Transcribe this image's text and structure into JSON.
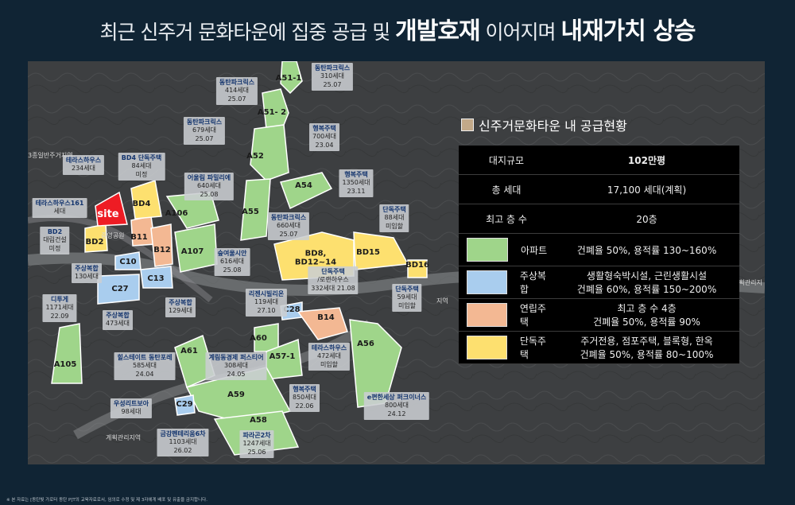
{
  "headline": {
    "p1": "최근 신주거 문화타운에 집중 공급 및 ",
    "b1": "개발호재",
    "p2": " 이어지며 ",
    "b2": "내재가치 상승"
  },
  "site_label": "site",
  "zones": {
    "A51_1": "A51-1",
    "A51_2": "A51-\n2",
    "A52": "A52",
    "A54": "A54",
    "A55": "A55",
    "A56": "A56",
    "A57": "A57-1",
    "A58": "A58",
    "A59": "A59",
    "A60": "A60",
    "A61": "A61",
    "A105": "A105",
    "A106": "A106",
    "A107": "A107",
    "B11": "B11",
    "B12": "B12",
    "B14": "B14",
    "BD2": "BD2",
    "BD4": "BD4",
    "BD8": "BD8,\nBD12~14",
    "BD15": "BD15",
    "BD16": "BD16",
    "C10": "C10",
    "C13": "C13",
    "C27": "C27",
    "C28": "C28",
    "C29": "C29"
  },
  "callouts": [
    {
      "name": "동탄파크릭스",
      "l2": "310세대",
      "l3": "25.07"
    },
    {
      "name": "동탄파크릭스",
      "l2": "414세대",
      "l3": "25.07"
    },
    {
      "name": "동탄파크릭스",
      "l2": "679세대",
      "l3": "25.07"
    },
    {
      "name": "행복주택",
      "l2": "700세대",
      "l3": "23.04"
    },
    {
      "name": "테라스하우스",
      "l2": "234세대",
      "l3": ""
    },
    {
      "name": "BD4 단독주택",
      "l2": "84세대",
      "l3": "미정"
    },
    {
      "name": "어울림 파밀리에",
      "l2": "640세대",
      "l3": "25.08"
    },
    {
      "name": "행복주택",
      "l2": "1350세대",
      "l3": "23.11"
    },
    {
      "name": "테라스하우스161",
      "l2": "세대",
      "l3": ""
    },
    {
      "name": "BD2",
      "l2": "대림건설",
      "l3": "미정"
    },
    {
      "name": "동탄파크릭스",
      "l2": "660세대",
      "l3": "25.07"
    },
    {
      "name": "단독주택",
      "l2": "88세대",
      "l3": "미입할"
    },
    {
      "name": "주상복합",
      "l2": "130세대",
      "l3": ""
    },
    {
      "name": "숲여울시안",
      "l2": "616세대",
      "l3": "25.08"
    },
    {
      "name": "단독주택",
      "l2": "/로랜하우스",
      "l3": "332세대 21.08"
    },
    {
      "name": "단독주택",
      "l2": "59세대",
      "l3": "미입할"
    },
    {
      "name": "디투게",
      "l2": "1171세대",
      "l3": "22.09"
    },
    {
      "name": "주상복합",
      "l2": "129세대",
      "l3": ""
    },
    {
      "name": "리젠시빌리온",
      "l2": "119세대",
      "l3": "27.10"
    },
    {
      "name": "주상복합",
      "l2": "473세대",
      "l3": ""
    },
    {
      "name": "힐스테이트 동탄포레",
      "l2": "585세대",
      "l3": "24.04"
    },
    {
      "name": "계림동경제 퍼스티어",
      "l2": "308세대",
      "l3": "24.05"
    },
    {
      "name": "테라스하우스",
      "l2": "472세대",
      "l3": "미입할"
    },
    {
      "name": "행복주택",
      "l2": "850세대",
      "l3": "22.06"
    },
    {
      "name": "e편한세상 퍼크이너스",
      "l2": "800세대",
      "l3": "24.12"
    },
    {
      "name": "우성리트보아",
      "l2": "98세대",
      "l3": ""
    },
    {
      "name": "금강펜테리움6차",
      "l2": "1103세대",
      "l3": "26.02"
    },
    {
      "name": "파라곤2차",
      "l2": "1247세대",
      "l3": "25.06"
    }
  ],
  "plain_labels": {
    "area1": "3종일반주거지역",
    "park": "중영공원",
    "area2": "계획관리지역",
    "area3": "계획관리지",
    "right_tag": "지역"
  },
  "panel": {
    "title": "신주거문화타운 내 공급현황",
    "rows": [
      {
        "k": "대지규모",
        "v": "102만평"
      },
      {
        "k": "총 세대",
        "v": "17,100 세대(계획)"
      },
      {
        "k": "최고 층 수",
        "v": "20층"
      }
    ],
    "legend": [
      {
        "name": "아파트",
        "color": "#9fd58a",
        "d1": "건폐율 50%, 용적률 130~160%",
        "d2": ""
      },
      {
        "name": "주상복합",
        "color": "#a9cdee",
        "d1": "생활형숙박시설, 근린생활시설",
        "d2": "건폐율 60%, 용적률 150~200%"
      },
      {
        "name": "연립주택",
        "color": "#f3b893",
        "d1": "최고 층 수 4층",
        "d2": "건폐율 50%, 용적률 90%"
      },
      {
        "name": "단독주택",
        "color": "#fde06f",
        "d1": "주거전용, 점포주택, 블록형, 한옥",
        "d2": "건폐율 50%, 용적률 80~100%"
      }
    ]
  },
  "footnote": "※ 본 자료는 [동탄빛 가로터 동탄 P]T의 교육자료로서, 임의로 수정 및 제 3자에게 배포 및 유출을 금지합니다."
}
